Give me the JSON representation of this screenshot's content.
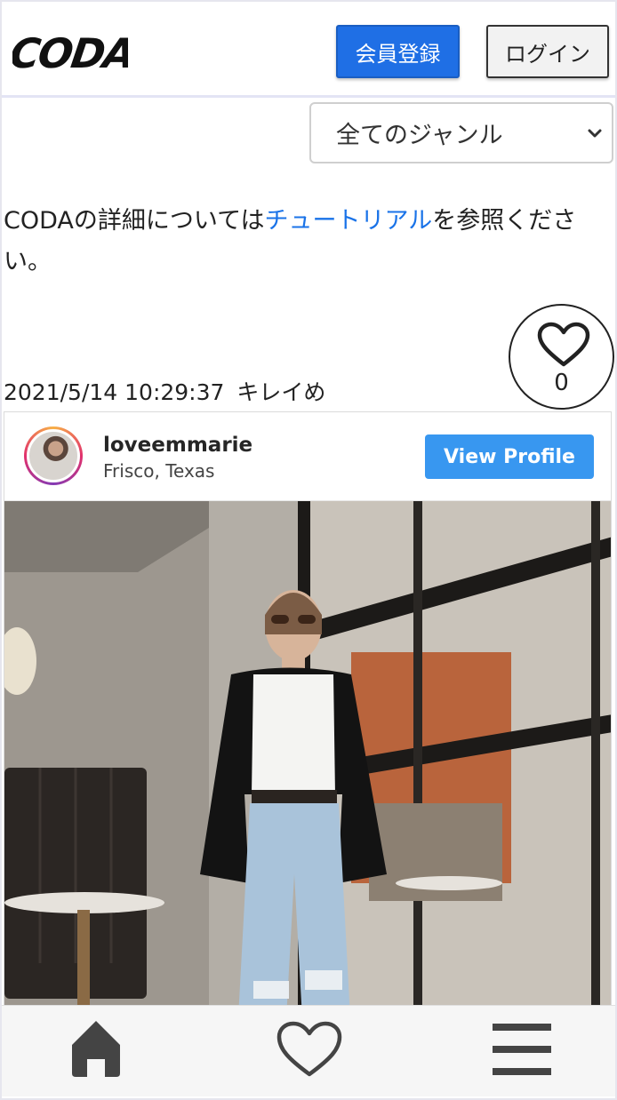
{
  "header": {
    "logo_text": "CODA",
    "register_label": "会員登録",
    "login_label": "ログイン"
  },
  "genre_select": {
    "selected": "全てのジャンル"
  },
  "info": {
    "prefix": "CODAの詳細については",
    "link_text": "チュートリアル",
    "suffix": "を参照ください。"
  },
  "post": {
    "like_count": "0",
    "datetime": "2021/5/14 10:29:37",
    "genre": "キレイめ",
    "instagram": {
      "username": "loveemmarie",
      "location": "Frisco, Texas",
      "view_profile_label": "View Profile"
    }
  },
  "nav": {
    "items": [
      {
        "icon": "home-icon"
      },
      {
        "icon": "heart-icon"
      },
      {
        "icon": "menu-icon"
      }
    ]
  },
  "colors": {
    "primary_button": "#1f6fe5",
    "link": "#1a73e8",
    "instagram_button": "#3897f0",
    "nav_icon": "#444444"
  }
}
